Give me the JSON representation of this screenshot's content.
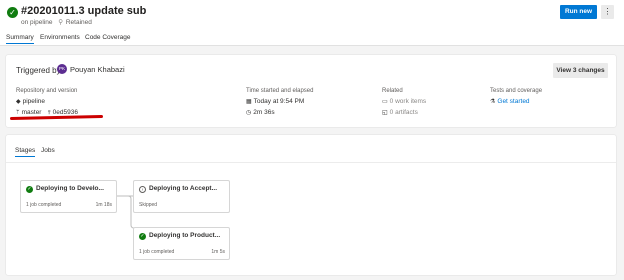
{
  "header": {
    "title": "#20201011.3 update sub",
    "pipeline": "on pipeline",
    "retained": "Retained",
    "status_icon": "check-circle-icon",
    "run_new": "Run new",
    "more": "⋮"
  },
  "tabs": [
    "Summary",
    "Environments",
    "Code Coverage"
  ],
  "summary": {
    "triggered_by_label": "Triggered by",
    "avatar_initials": "PK",
    "user": "Pouyan Khabazi",
    "view_changes": "View 3 changes",
    "repo_label": "Repository and version",
    "repo_name": "pipeline",
    "branch": "master",
    "commit": "0ed5936",
    "time_label": "Time started and elapsed",
    "started": "Today at 9:54 PM",
    "elapsed": "2m 36s",
    "related_label": "Related",
    "work_items": "0 work items",
    "artifacts": "0 artifacts",
    "tests_label": "Tests and coverage",
    "get_started": "Get started"
  },
  "stages_panel": {
    "tabs": [
      "Stages",
      "Jobs"
    ],
    "stages": [
      {
        "name": "Deploying to Develo...",
        "status": "succeeded",
        "meta": "1 job completed",
        "duration": "1m 18s"
      },
      {
        "name": "Deploying to Accept...",
        "status": "skipped",
        "meta": "Skipped",
        "duration": ""
      },
      {
        "name": "Deploying to Product...",
        "status": "succeeded",
        "meta": "1 job completed",
        "duration": "1m 5s"
      }
    ]
  },
  "colors": {
    "accent": "#0078d4",
    "success": "#107c10",
    "annotation": "#cc0000"
  }
}
